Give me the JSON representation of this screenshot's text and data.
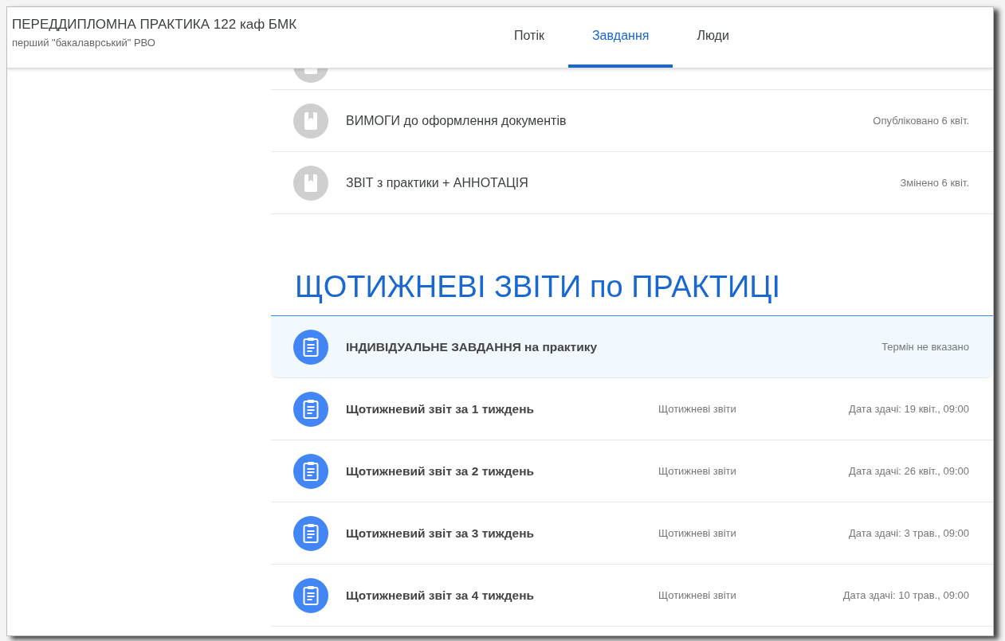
{
  "course": {
    "title": "ПЕРЕДДИПЛОМНА ПРАКТИКА 122 каф БМК",
    "subtitle": "перший \"бакалаврський\" РВО"
  },
  "tabs": [
    {
      "label": "Потік",
      "selected": false
    },
    {
      "label": "Завдання",
      "selected": true
    },
    {
      "label": "Люди",
      "selected": false
    }
  ],
  "materials": [
    {
      "kind": "material",
      "title": "ВИМОГИ до оформлення документів",
      "meta": "Опубліковано 6 квіт."
    },
    {
      "kind": "material",
      "title": "ЗВІТ з практики + АННОТАЦІЯ",
      "meta": "Змінено 6 квіт."
    }
  ],
  "section": {
    "title": "ЩОТИЖНЕВІ ЗВІТИ по ПРАКТИЦІ"
  },
  "items": [
    {
      "kind": "assignment",
      "title": "ІНДИВІДУАЛЬНЕ ЗАВДАННЯ на практику",
      "meta": "Термін не вказано",
      "selected": true
    },
    {
      "kind": "assignment",
      "title": "Щотижневий звіт за 1 тиждень",
      "topic": "Щотижневі звіти",
      "meta": "Дата здачі: 19 квіт., 09:00",
      "selected": false
    },
    {
      "kind": "assignment",
      "title": "Щотижневий звіт за 2 тиждень",
      "topic": "Щотижневі звіти",
      "meta": "Дата здачі: 26 квіт., 09:00",
      "selected": false
    },
    {
      "kind": "assignment",
      "title": "Щотижневий звіт за 3 тиждень",
      "topic": "Щотижневі звіти",
      "meta": "Дата здачі: 3 трав., 09:00",
      "selected": false
    },
    {
      "kind": "assignment",
      "title": "Щотижневий звіт за 4 тиждень",
      "topic": "Щотижневі звіти",
      "meta": "Дата здачі: 10 трав., 09:00",
      "selected": false
    }
  ]
}
